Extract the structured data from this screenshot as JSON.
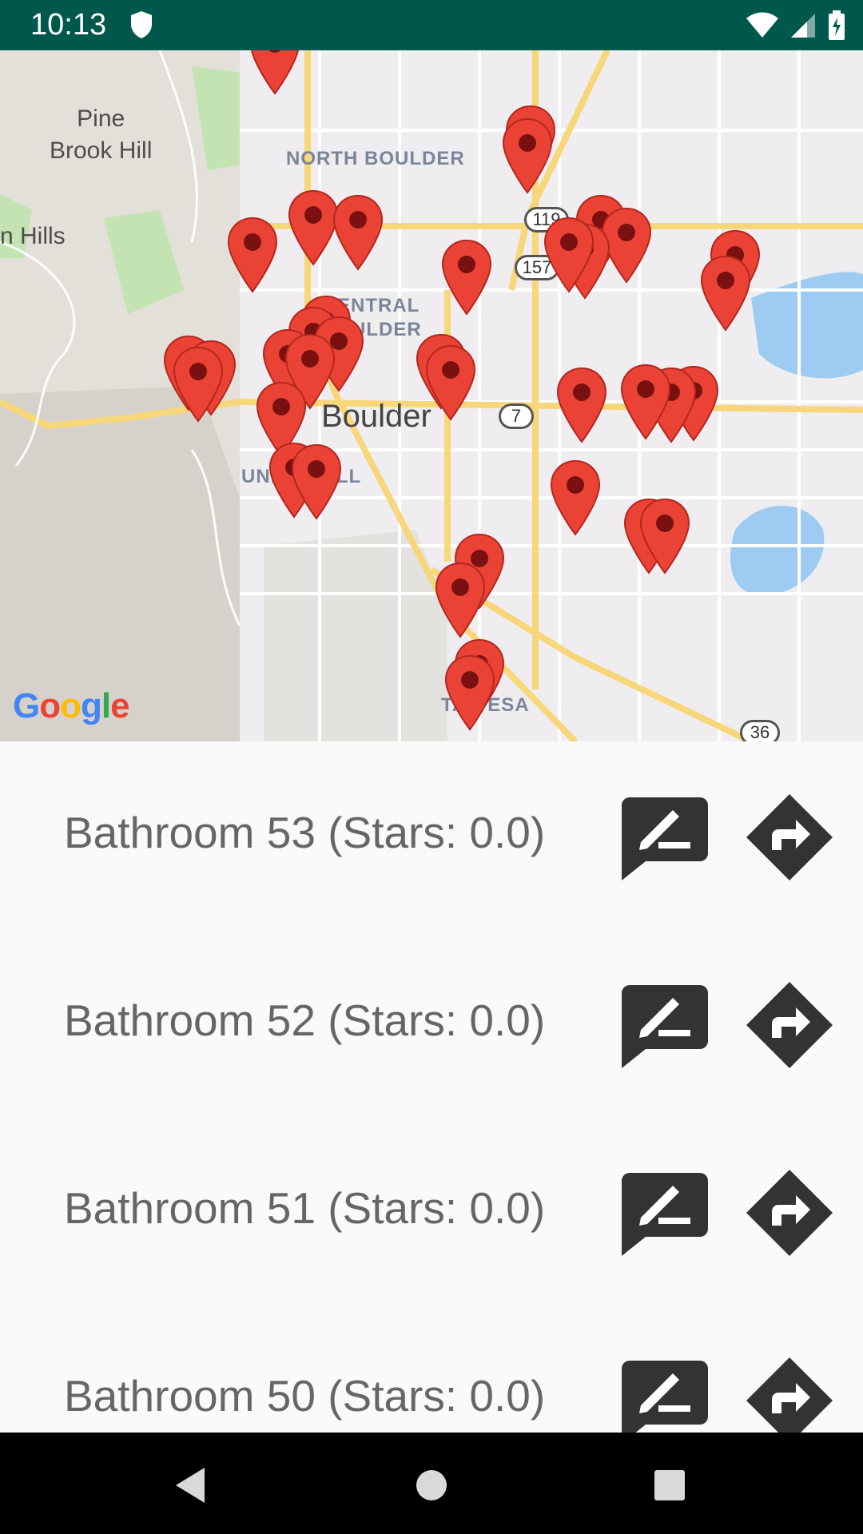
{
  "status_bar": {
    "time": "10:13",
    "icons": [
      "shield-icon",
      "wifi-icon",
      "signal-icon",
      "battery-charging-icon"
    ],
    "background": "#00574b"
  },
  "map": {
    "labels": {
      "pine_brook_hill_line1": "Pine",
      "pine_brook_hill_line2": "Brook Hill",
      "hills_partial": "n Hills",
      "north_boulder": "NORTH BOULDER",
      "central_boulder_line1": "ENTRAL",
      "central_boulder_line2": "ULDER",
      "boulder": "Boulder",
      "university_hill": "UNIV        Y HILL",
      "table_mesa": "TAB        ESA"
    },
    "route_shields": [
      "119",
      "157",
      "7",
      "36"
    ],
    "logo_text": "Google",
    "marker_color": "#ea4335",
    "marker_count": 34
  },
  "list": {
    "rows": [
      {
        "label": "Bathroom 53 (Stars: 0.0)"
      },
      {
        "label": "Bathroom 52 (Stars: 0.0)"
      },
      {
        "label": "Bathroom 51 (Stars: 0.0)"
      },
      {
        "label": "Bathroom 50 (Stars: 0.0)"
      }
    ],
    "icon_color": "#333333"
  },
  "nav_bar": {
    "icons": [
      "back-icon",
      "home-icon",
      "recents-icon"
    ]
  }
}
